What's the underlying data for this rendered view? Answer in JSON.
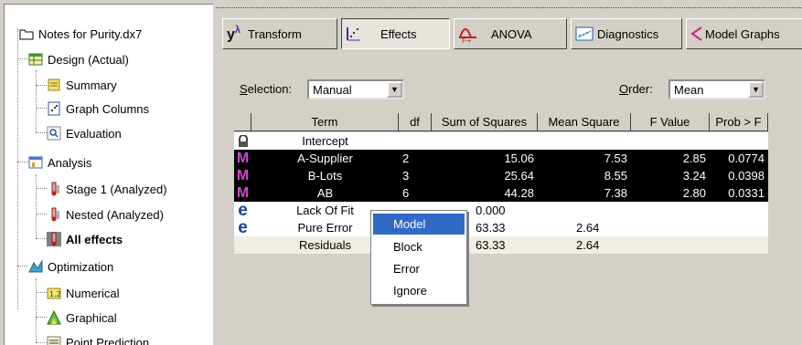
{
  "tree": {
    "root": "Notes for Purity.dx7",
    "design": "Design (Actual)",
    "summary": "Summary",
    "graph_columns": "Graph Columns",
    "evaluation": "Evaluation",
    "analysis": "Analysis",
    "stage1": "Stage 1 (Analyzed)",
    "nested": "Nested (Analyzed)",
    "all_effects": "All effects",
    "optimization": "Optimization",
    "numerical": "Numerical",
    "graphical": "Graphical",
    "point_prediction": "Point Prediction"
  },
  "tabs": {
    "transform": "Transform",
    "effects": "Effects",
    "anova": "ANOVA",
    "diagnostics": "Diagnostics",
    "model_graphs": "Model Graphs"
  },
  "controls": {
    "selection_label_u": "S",
    "selection_label_rest": "election:",
    "selection_value": "Manual",
    "order_label_u": "O",
    "order_label_rest": "rder:",
    "order_value": "Mean"
  },
  "grid": {
    "headers": [
      "Term",
      "df",
      "Sum of Squares",
      "Mean Square",
      "F Value",
      "Prob > F"
    ],
    "rows": [
      {
        "icon": "lock-icon",
        "term": "Intercept",
        "df": "",
        "ss": "",
        "ms": "",
        "f": "",
        "p": ""
      },
      {
        "icon": "model-m-icon",
        "term": "A-Supplier",
        "df": "2",
        "ss": "15.06",
        "ms": "7.53",
        "f": "2.85",
        "p": "0.0774"
      },
      {
        "icon": "model-m-icon",
        "term": "B-Lots",
        "df": "3",
        "ss": "25.64",
        "ms": "8.55",
        "f": "3.24",
        "p": "0.0398"
      },
      {
        "icon": "model-m-icon",
        "term": "AB",
        "df": "6",
        "ss": "44.28",
        "ms": "7.38",
        "f": "2.80",
        "p": "0.0331"
      },
      {
        "icon": "error-e-icon",
        "term": "Lack Of Fit",
        "df": "",
        "ss": "0.000",
        "ms": "",
        "f": "",
        "p": ""
      },
      {
        "icon": "error-e-icon",
        "term": "Pure Error",
        "df": "",
        "ss": "63.33",
        "ms": "2.64",
        "f": "",
        "p": ""
      },
      {
        "icon": "",
        "term": "Residuals",
        "df": "",
        "ss": "63.33",
        "ms": "2.64",
        "f": "",
        "p": ""
      }
    ]
  },
  "context_menu": {
    "items": [
      "Model",
      "Block",
      "Error",
      "Ignore"
    ],
    "highlighted": "Model"
  },
  "colors": {
    "selected_row_bg": "#000000",
    "menu_highlight": "#3169c6",
    "model_icon": "#d048d0",
    "error_icon": "#1c3f9c"
  }
}
